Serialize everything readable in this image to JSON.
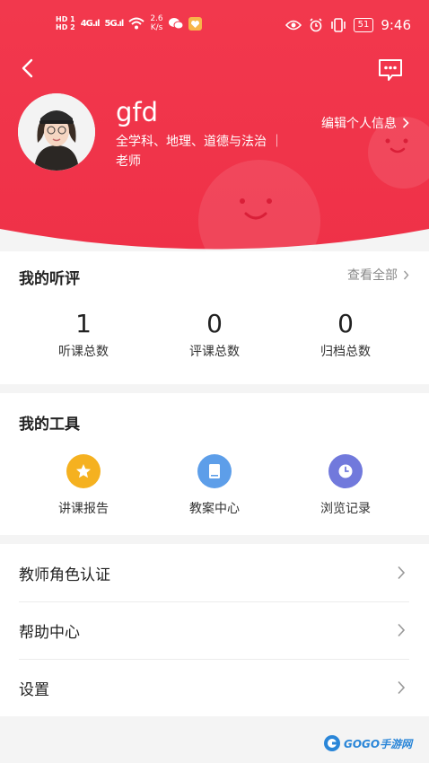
{
  "status_bar": {
    "hd_top": "HD 1",
    "hd_bottom": "HD 2",
    "signal_1": "4G",
    "signal_2": "5G",
    "speed_value": "2.6",
    "speed_unit": "K/s",
    "battery": "51",
    "time": "9:46"
  },
  "profile": {
    "username": "gfd",
    "subjects": "全学科、地理、道德与法治 ｜",
    "role": "老师",
    "edit_label": "编辑个人信息"
  },
  "reviews": {
    "title": "我的听评",
    "view_all": "查看全部",
    "stats": [
      {
        "value": "1",
        "label": "听课总数"
      },
      {
        "value": "0",
        "label": "评课总数"
      },
      {
        "value": "0",
        "label": "归档总数"
      }
    ]
  },
  "tools": {
    "title": "我的工具",
    "items": [
      {
        "label": "讲课报告",
        "icon": "star-icon",
        "color": "#f5b120"
      },
      {
        "label": "教案中心",
        "icon": "book-icon",
        "color": "#5d9ee9"
      },
      {
        "label": "浏览记录",
        "icon": "clock-icon",
        "color": "#7179dc"
      }
    ]
  },
  "menu": [
    {
      "label": "教师角色认证"
    },
    {
      "label": "帮助中心"
    },
    {
      "label": "设置"
    }
  ],
  "watermark": {
    "text": "GOGO手游网"
  },
  "colors": {
    "header_red": "#f23a4e",
    "header_red_dark": "#e5263f"
  }
}
